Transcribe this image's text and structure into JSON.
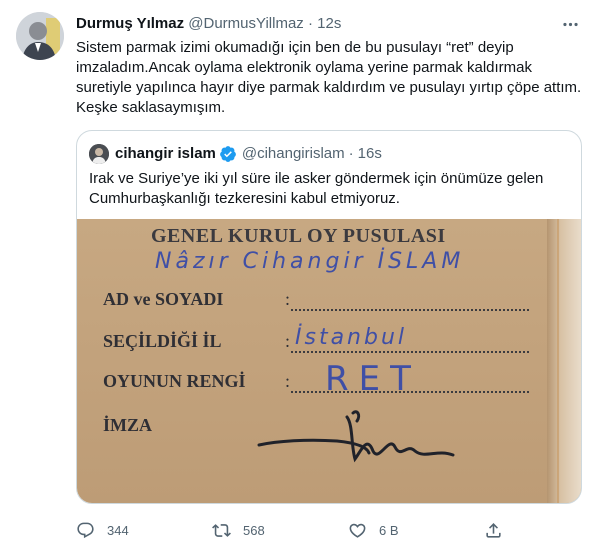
{
  "tweet": {
    "author_name": "Durmuş Yılmaz",
    "author_handle": "@DurmusYillmaz",
    "separator": "·",
    "time": "12s",
    "text": "Sistem parmak izimi okumadığı için ben de bu pusulayı “ret” deyip imzaladım.Ancak oylama elektronik oylama yerine parmak kaldırmak suretiyle yapılınca hayır diye parmak kaldırdım ve pusulayı yırtıp çöpe attım. Keşke saklasaymışım."
  },
  "quoted": {
    "author_name": "cihangir islam",
    "author_handle": "@cihangirislam",
    "separator": "·",
    "time": "16s",
    "text": "Irak ve Suriye’ye iki yıl süre ile asker göndermek için önümüze gelen Cumhurbaşkanlığı tezkeresini kabul etmiyoruz.",
    "image": {
      "title": "GENEL KURUL OY PUSULASI",
      "handwritten_name": "Nâzır Cihangir İSLAM",
      "fields": [
        {
          "label": "AD ve SOYADI",
          "colon": ":",
          "value": ""
        },
        {
          "label": "SEÇİLDİĞİ İL",
          "colon": ":",
          "value": "İstanbul"
        },
        {
          "label": "OYUNUN RENGİ",
          "colon": ":",
          "value": "RET"
        },
        {
          "label": "İMZA",
          "colon": "",
          "value": ""
        }
      ]
    }
  },
  "actions": {
    "reply_count": "344",
    "retweet_count": "568",
    "like_count": "6 B",
    "share_label": ""
  },
  "icons": {
    "more": "more-horizontal-icon",
    "reply": "reply-icon",
    "retweet": "retweet-icon",
    "like": "heart-icon",
    "share": "share-icon",
    "verified": "verified-badge-icon"
  },
  "colors": {
    "text": "#0f1419",
    "secondary": "#536471",
    "border": "#cfd9de",
    "verified": "#1d9bf0"
  }
}
